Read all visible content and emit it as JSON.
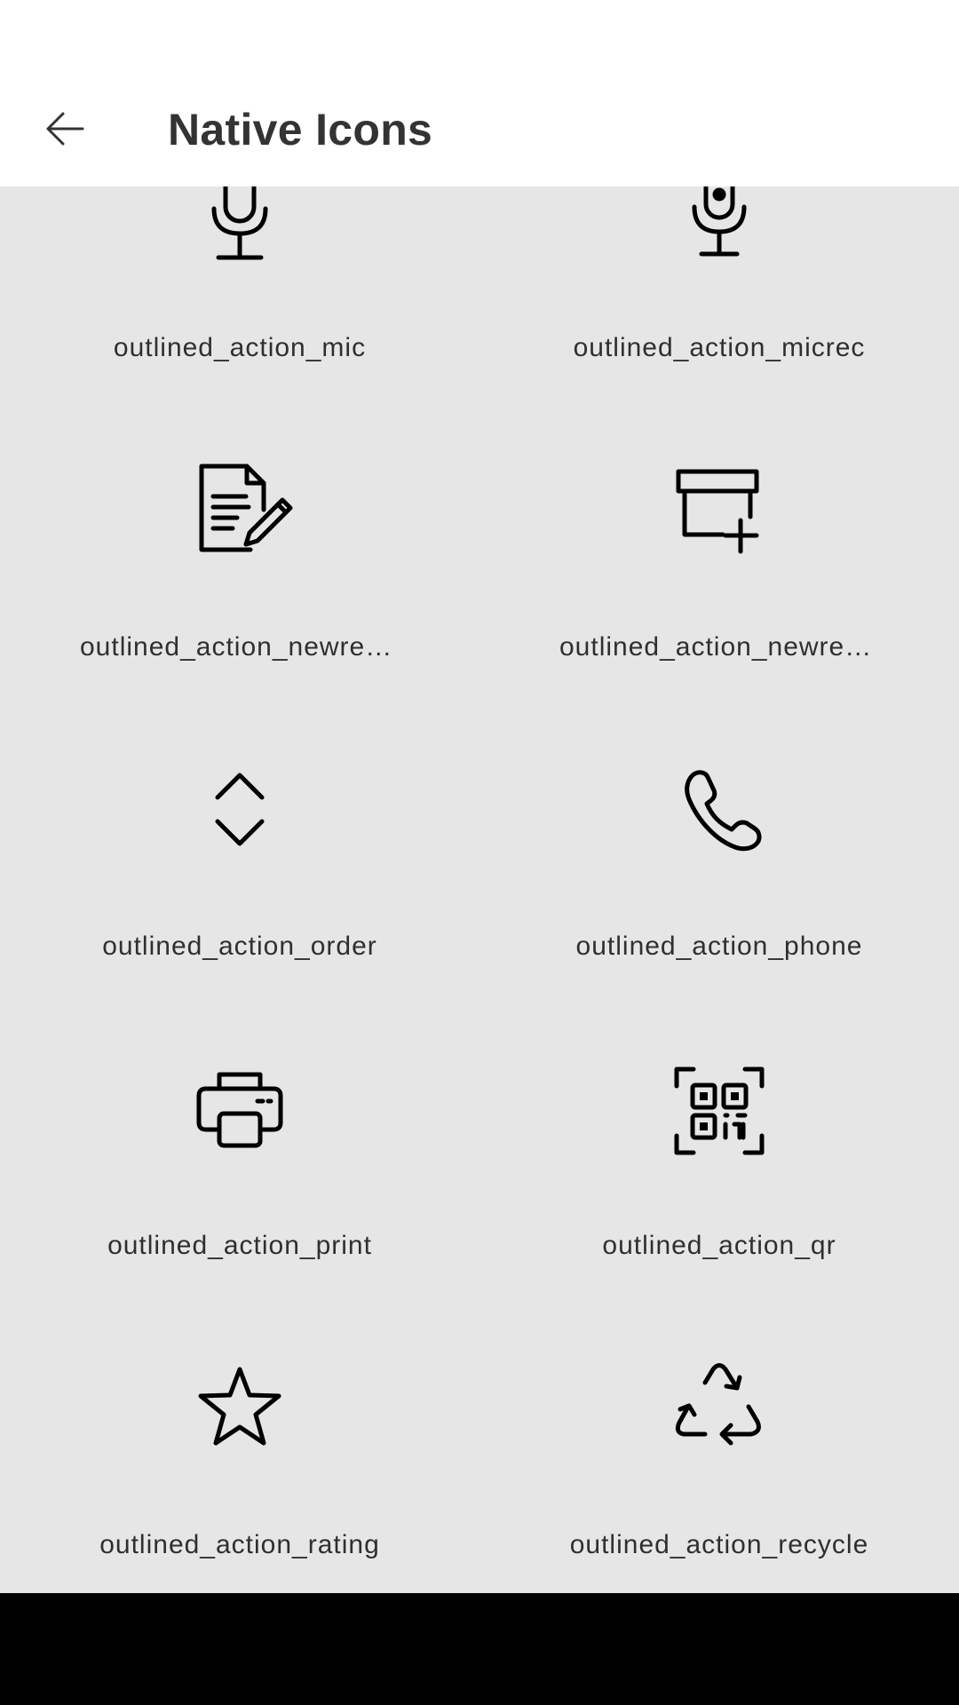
{
  "app_bar": {
    "title": "Native Icons",
    "back_icon": "arrow-left-icon"
  },
  "icons": [
    {
      "label": "outlined_action_mic",
      "icon": "mic-icon"
    },
    {
      "label": "outlined_action_micrec",
      "icon": "mic-record-icon"
    },
    {
      "label": "outlined_action_newrecord",
      "icon": "document-edit-icon"
    },
    {
      "label": "outlined_action_newrecord",
      "icon": "archive-add-icon"
    },
    {
      "label": "outlined_action_order",
      "icon": "sort-order-icon"
    },
    {
      "label": "outlined_action_phone",
      "icon": "phone-icon"
    },
    {
      "label": "outlined_action_print",
      "icon": "printer-icon"
    },
    {
      "label": "outlined_action_qr",
      "icon": "qr-code-icon"
    },
    {
      "label": "outlined_action_rating",
      "icon": "star-icon"
    },
    {
      "label": "outlined_action_recycle",
      "icon": "recycle-icon"
    }
  ],
  "colors": {
    "background": "#e6e6e7",
    "app_bar": "#ffffff",
    "title_text": "#333333",
    "label_text": "#2f2f2f",
    "icon_stroke": "#000000",
    "nav_bar": "#000000"
  }
}
